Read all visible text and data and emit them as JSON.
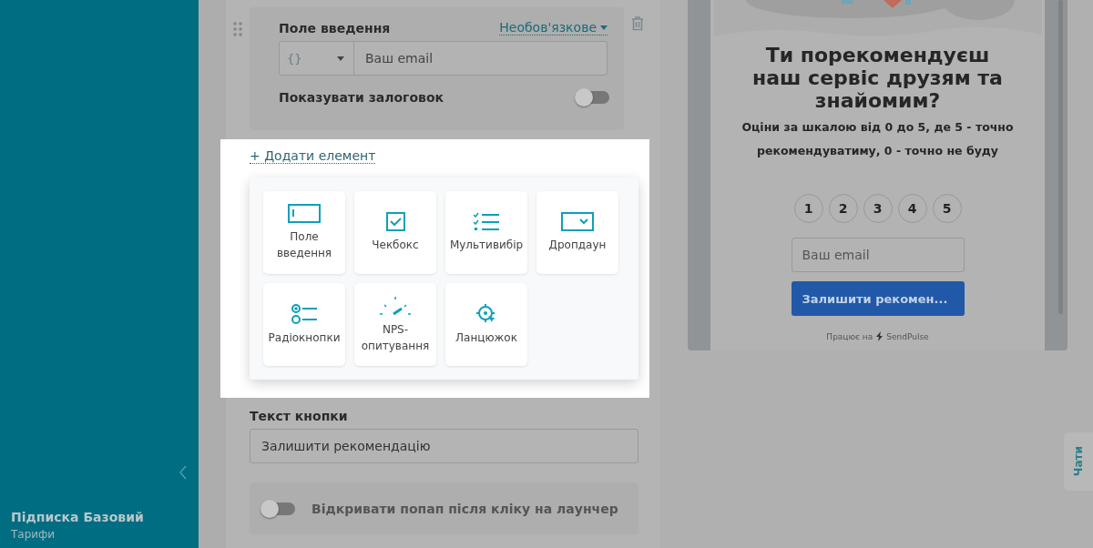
{
  "sidebar": {
    "plan_title": "Підписка Базовий",
    "plan_link": "Тарифи"
  },
  "field_card": {
    "title": "Поле введення",
    "requirement": "Необов'язкове",
    "variable_prefix": "{}",
    "placeholder": "Ваш email",
    "show_title": {
      "label": "Показувати залоговок",
      "on": false
    }
  },
  "add_element": "+ Додати елемент",
  "element_menu": [
    {
      "label": "Поле введення",
      "kind": "input"
    },
    {
      "label": "Чекбокс",
      "kind": "checkbox"
    },
    {
      "label": "Мультивибір",
      "kind": "multiselect"
    },
    {
      "label": "Дропдаун",
      "kind": "dropdown"
    },
    {
      "label": "Радіокнопки",
      "kind": "radio"
    },
    {
      "label": "NPS-опитування",
      "kind": "nps"
    },
    {
      "label": "Ланцюжок",
      "kind": "chain"
    }
  ],
  "button_text": {
    "label": "Текст кнопки",
    "value": "Залишити рекомендацію"
  },
  "open_popup": {
    "label": "Відкривати попап після кліку на лаунчер",
    "on": false
  },
  "preview": {
    "title": "Ти порекомендуєш наш сервіс друзям та знайомим?",
    "subtitle": "Оціни за шкалою від 0 до 5, де 5 - точно рекомендуватиму, 0 - точно не буду",
    "scale": [
      "1",
      "2",
      "3",
      "4",
      "5"
    ],
    "email_placeholder": "Ваш email",
    "submit": "Залишити рекомен...",
    "powered_by": "Працює на",
    "brand": "SendPulse"
  },
  "chat_tab": "Чати"
}
